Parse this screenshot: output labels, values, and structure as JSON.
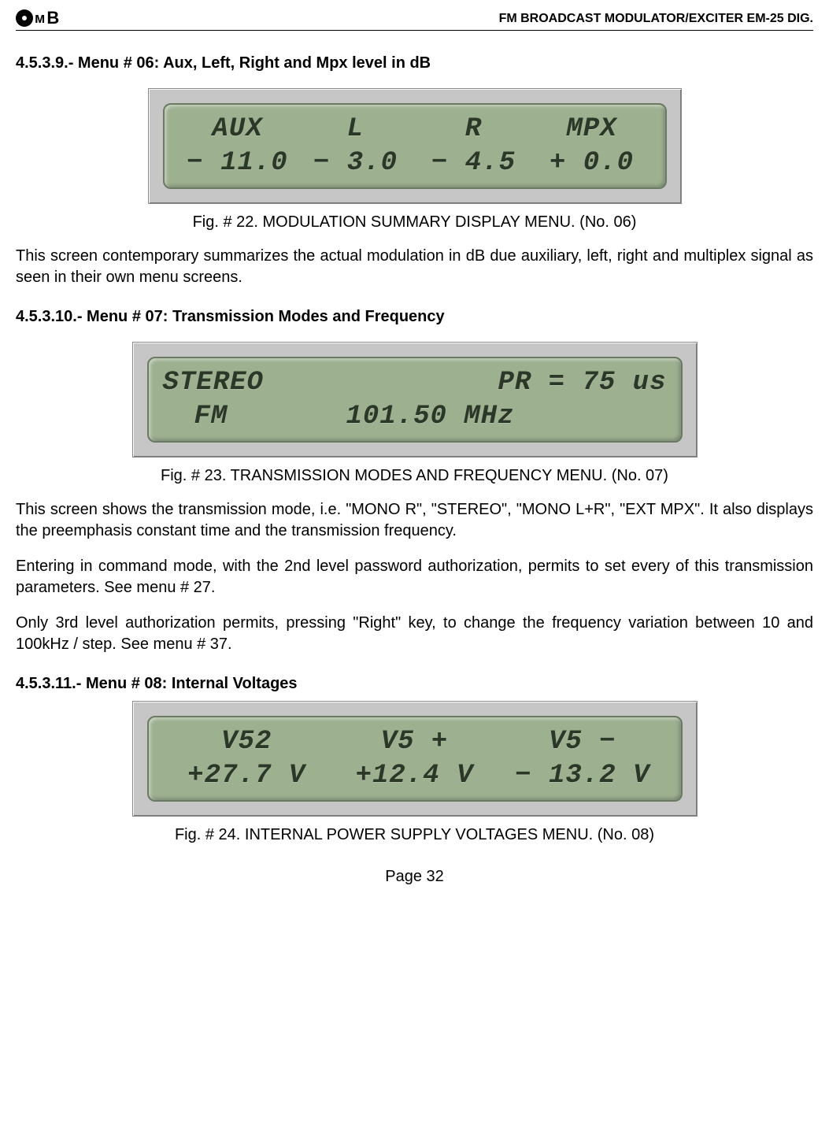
{
  "header": {
    "title": "FM BROADCAST MODULATOR/EXCITER EM-25 DIG."
  },
  "section1": {
    "heading": "4.5.3.9.- Menu # 06: Aux, Left, Right and Mpx level in dB",
    "lcd": {
      "row1": {
        "c1": "AUX",
        "c2": "L",
        "c3": "R",
        "c4": "MPX"
      },
      "row2": {
        "c1": "− 11.0",
        "c2": "− 3.0",
        "c3": "− 4.5",
        "c4": "+ 0.0"
      }
    },
    "caption": "Fig. # 22. MODULATION SUMMARY DISPLAY MENU. (No. 06)",
    "para1": "This screen contemporary summarizes the actual modulation in dB due auxiliary, left, right and multiplex signal as seen in their own menu screens."
  },
  "section2": {
    "heading": "4.5.3.10.- Menu # 07: Transmission Modes and Frequency",
    "lcd": {
      "row1": {
        "c1": "STEREO",
        "c2": "PR = 75 us"
      },
      "row2": {
        "c1": "FM",
        "c2": "101.50 MHz"
      }
    },
    "caption": "Fig. # 23. TRANSMISSION MODES AND FREQUENCY MENU. (No. 07)",
    "para1": "This screen shows the transmission mode, i.e. \"MONO R\", \"STEREO\", \"MONO L+R\", \"EXT MPX\". It also displays the preemphasis constant time and the transmission frequency.",
    "para2": "Entering in command mode, with the 2nd level password authorization, permits to set every of this transmission parameters. See menu # 27.",
    "para3": "Only 3rd level authorization permits, pressing \"Right\" key, to change the frequency variation between 10 and 100kHz / step. See menu # 37."
  },
  "section3": {
    "heading": "4.5.3.11.- Menu # 08: Internal Voltages",
    "lcd": {
      "row1": {
        "c1": "V52",
        "c2": "V5 +",
        "c3": "V5 −"
      },
      "row2": {
        "c1": "+27.7 V",
        "c2": "+12.4 V",
        "c3": "− 13.2 V"
      }
    },
    "caption": "Fig. # 24. INTERNAL POWER SUPPLY VOLTAGES MENU. (No. 08)"
  },
  "footer": {
    "pageNumber": "Page 32"
  }
}
